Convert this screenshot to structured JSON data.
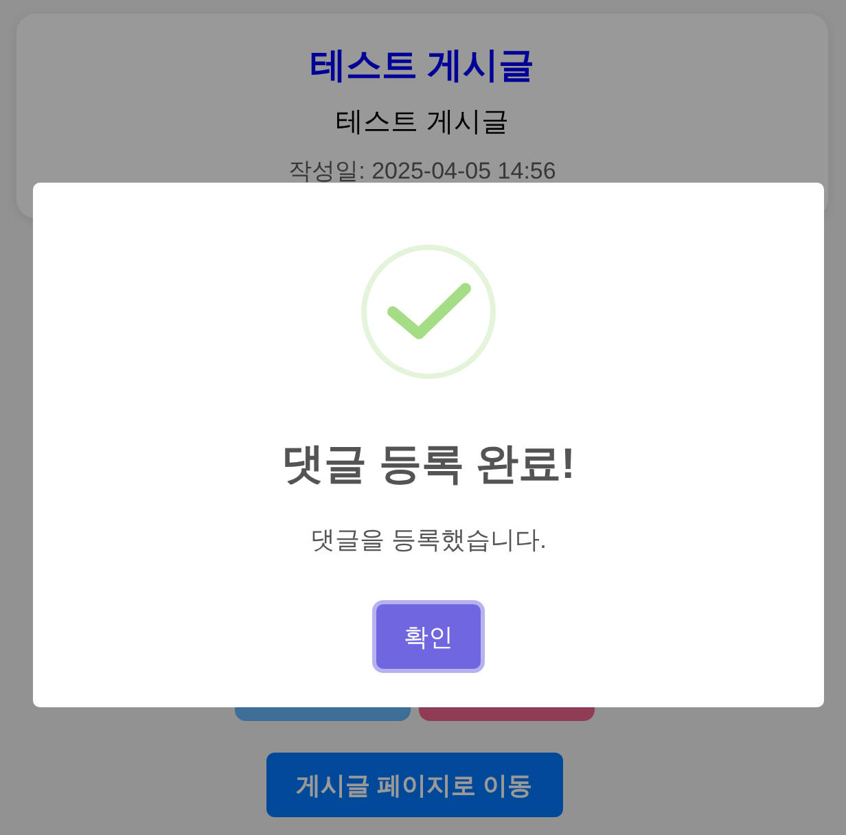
{
  "post": {
    "title": "테스트 게시글",
    "content": "테스트 게시글",
    "date": "작성일: 2025-04-05 14:56"
  },
  "action_buttons": [
    {
      "kind": "primary"
    },
    {
      "kind": "danger"
    }
  ],
  "nav_button": {
    "label": "게시글 페이지로 이동"
  },
  "dialog": {
    "kind": "success",
    "title": "댓글 등록 완료!",
    "message": "댓글을 등록했습니다.",
    "confirm_button": {
      "label": "확인",
      "focused": true
    }
  }
}
